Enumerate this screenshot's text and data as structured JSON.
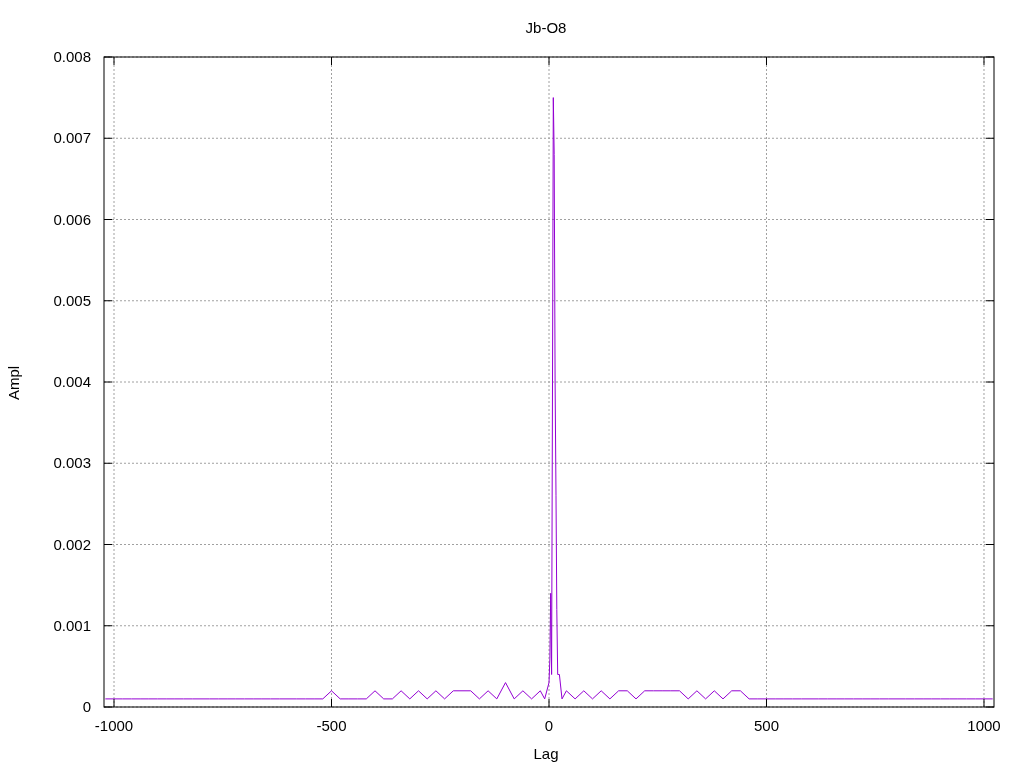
{
  "chart": {
    "chart_data": {
      "type": "line",
      "title": "Jb-O8",
      "xlabel": "Lag",
      "ylabel": "Ampl",
      "xlim": [
        -1023,
        1023
      ],
      "ylim": [
        0,
        0.008
      ],
      "grid": true,
      "xticks": [
        -1000,
        -500,
        0,
        500,
        1000
      ],
      "yticks": [
        {
          "value": 0,
          "label": "0"
        },
        {
          "value": 0.001,
          "label": "0.001"
        },
        {
          "value": 0.002,
          "label": "0.002"
        },
        {
          "value": 0.003,
          "label": "0.003"
        },
        {
          "value": 0.004,
          "label": "0.004"
        },
        {
          "value": 0.005,
          "label": "0.005"
        },
        {
          "value": 0.006,
          "label": "0.006"
        },
        {
          "value": 0.007,
          "label": "0.007"
        },
        {
          "value": 0.008,
          "label": "0.008"
        }
      ],
      "x": [
        -1020,
        -1000,
        -980,
        -960,
        -940,
        -920,
        -900,
        -880,
        -860,
        -840,
        -820,
        -800,
        -780,
        -760,
        -740,
        -720,
        -700,
        -680,
        -660,
        -640,
        -620,
        -600,
        -580,
        -560,
        -540,
        -520,
        -500,
        -480,
        -460,
        -440,
        -420,
        -400,
        -380,
        -360,
        -340,
        -320,
        -300,
        -280,
        -260,
        -240,
        -220,
        -200,
        -180,
        -160,
        -140,
        -120,
        -100,
        -80,
        -60,
        -40,
        -20,
        -10,
        0,
        2,
        4,
        6,
        8,
        10,
        12,
        14,
        16,
        18,
        20,
        24,
        30,
        40,
        60,
        80,
        100,
        120,
        140,
        160,
        180,
        200,
        220,
        240,
        260,
        280,
        300,
        320,
        340,
        360,
        380,
        400,
        420,
        440,
        460,
        480,
        500,
        520,
        540,
        560,
        580,
        600,
        620,
        640,
        660,
        680,
        700,
        720,
        740,
        760,
        780,
        800,
        820,
        840,
        860,
        880,
        900,
        920,
        940,
        960,
        980,
        1000,
        1020
      ],
      "series": [
        {
          "color": "#9400d3",
          "values": [
            0.0001,
            0.0001,
            0.0001,
            0.0001,
            0.0001,
            0.0001,
            0.0001,
            0.0001,
            0.0001,
            0.0001,
            0.0001,
            0.0001,
            0.0001,
            0.0001,
            0.0001,
            0.0001,
            0.0001,
            0.0001,
            0.0001,
            0.0001,
            0.0001,
            0.0001,
            0.0001,
            0.0001,
            0.0001,
            0.0001,
            0.0002,
            0.0001,
            0.0001,
            0.0001,
            0.0001,
            0.0002,
            0.0001,
            0.0001,
            0.0002,
            0.0001,
            0.0002,
            0.0001,
            0.0002,
            0.0001,
            0.0002,
            0.0002,
            0.0002,
            0.0001,
            0.0002,
            0.0001,
            0.0003,
            0.0001,
            0.0002,
            0.0001,
            0.0002,
            0.0001,
            0.0003,
            0.0006,
            0.0014,
            0.0004,
            0.004,
            0.0075,
            0.0068,
            0.004,
            0.0026,
            0.0012,
            0.0004,
            0.0004,
            0.0001,
            0.0002,
            0.0001,
            0.0002,
            0.0001,
            0.0002,
            0.0001,
            0.0002,
            0.0002,
            0.0001,
            0.0002,
            0.0002,
            0.0002,
            0.0002,
            0.0002,
            0.0001,
            0.0002,
            0.0001,
            0.0002,
            0.0001,
            0.0002,
            0.0002,
            0.0001,
            0.0001,
            0.0001,
            0.0001,
            0.0001,
            0.0001,
            0.0001,
            0.0001,
            0.0001,
            0.0001,
            0.0001,
            0.0001,
            0.0001,
            0.0001,
            0.0001,
            0.0001,
            0.0001,
            0.0001,
            0.0001,
            0.0001,
            0.0001,
            0.0001,
            0.0001,
            0.0001,
            0.0001,
            0.0001,
            0.0001,
            0.0001,
            0.0001
          ]
        }
      ]
    }
  }
}
